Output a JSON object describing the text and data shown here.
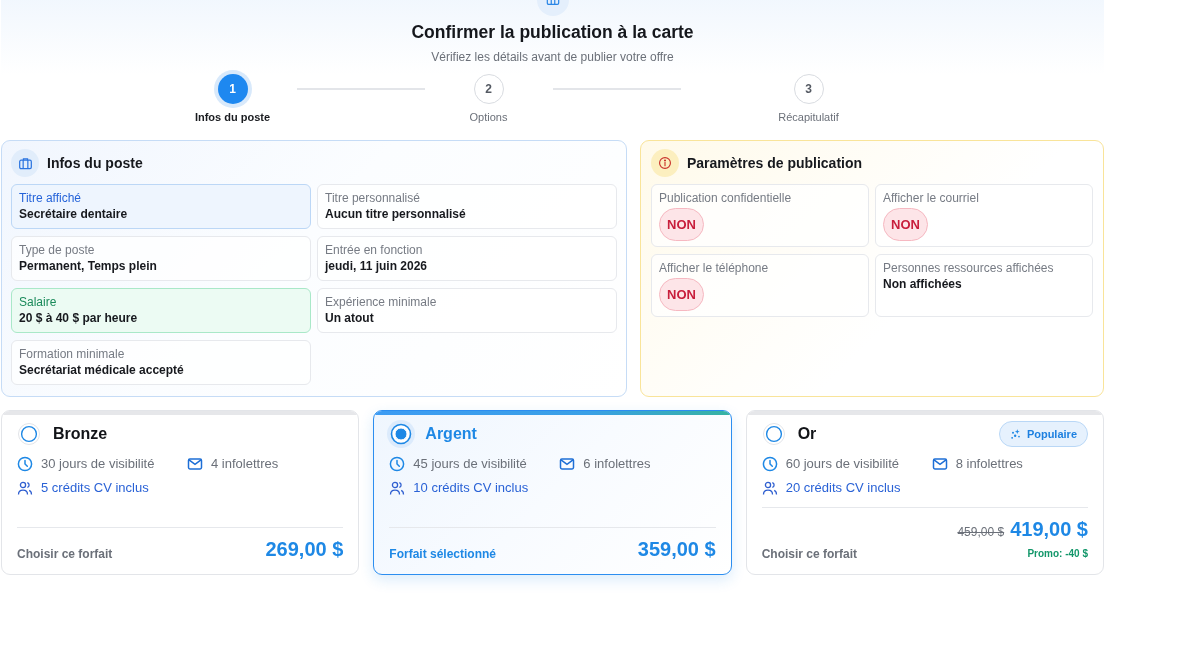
{
  "header": {
    "title": "Confirmer la publication à la carte",
    "subtitle": "Vérifiez les détails avant de publier votre offre"
  },
  "steps": [
    {
      "number": "1",
      "label": "Infos du poste",
      "selected": true
    },
    {
      "number": "2",
      "label": "Options",
      "selected": false
    },
    {
      "number": "3",
      "label": "Récapitulatif",
      "selected": false
    }
  ],
  "job_info": {
    "title": "Infos du poste",
    "fields": [
      {
        "label": "Titre affiché",
        "value": "Secrétaire dentaire",
        "kind": "primary"
      },
      {
        "label": "Titre personnalisé",
        "value": "Aucun titre personnalisé",
        "kind": "plain"
      },
      {
        "label": "Type de poste",
        "value": "Permanent, Temps plein",
        "kind": "plain"
      },
      {
        "label": "Entrée en fonction",
        "value": "jeudi, 11 juin 2026",
        "kind": "plain"
      },
      {
        "label": "Salaire",
        "value": "20 $ à 40 $ par heure",
        "kind": "success"
      },
      {
        "label": "Expérience minimale",
        "value": "Un atout",
        "kind": "plain"
      },
      {
        "label": "Formation minimale",
        "value": "Secrétariat médicale accepté",
        "kind": "plain"
      }
    ]
  },
  "publication_settings": {
    "title": "Paramètres de publication",
    "fields": [
      {
        "label": "Publication confidentielle",
        "kind": "badge",
        "value": "NON",
        "on": false
      },
      {
        "label": "Afficher le courriel",
        "kind": "badge",
        "value": "NON",
        "on": false
      },
      {
        "label": "Afficher le téléphone",
        "kind": "badge",
        "value": "NON",
        "on": false
      },
      {
        "label": "Personnes ressources affichées",
        "kind": "text",
        "value": "Non affichées"
      }
    ]
  },
  "plans": [
    {
      "name": "Bronze",
      "selected": false,
      "features": [
        {
          "kind": "duration",
          "text": "30 jours de visibilité"
        },
        {
          "kind": "newsletters",
          "text": "4 infolettres"
        },
        {
          "kind": "credits",
          "text": "5 crédits CV inclus"
        }
      ],
      "action": "Choisir ce forfait",
      "price": "269,00 $"
    },
    {
      "name": "Argent",
      "selected": true,
      "features": [
        {
          "kind": "duration",
          "text": "45 jours de visibilité"
        },
        {
          "kind": "newsletters",
          "text": "6 infolettres"
        },
        {
          "kind": "credits",
          "text": "10 crédits CV inclus"
        }
      ],
      "action": "Forfait sélectionné",
      "price": "359,00 $"
    },
    {
      "name": "Or",
      "selected": false,
      "badge": "Populaire",
      "features": [
        {
          "kind": "duration",
          "text": "60 jours de visibilité"
        },
        {
          "kind": "newsletters",
          "text": "8 infolettres"
        },
        {
          "kind": "credits",
          "text": "20 crédits CV inclus"
        }
      ],
      "action": "Choisir ce forfait",
      "old_price": "459,00 $",
      "price": "419,00 $",
      "promo": "Promo: -40 $"
    }
  ]
}
